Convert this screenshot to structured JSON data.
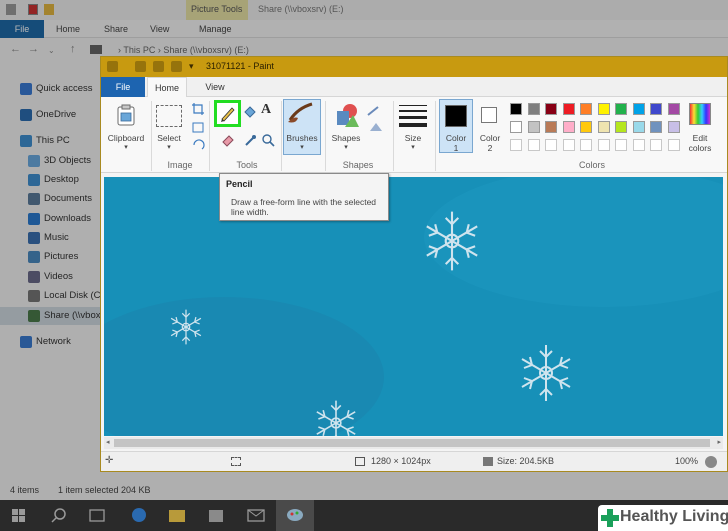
{
  "explorer": {
    "tools_tab": "Picture Tools",
    "title": "Share (\\\\vboxsrv) (E:)",
    "tabs": {
      "file": "File",
      "home": "Home",
      "share": "Share",
      "view": "View",
      "manage": "Manage"
    },
    "breadcrumb": "› This PC › Share (\\\\vboxsrv) (E:)",
    "nav": [
      {
        "label": "Quick access",
        "icon": "star-icon",
        "color": "#3a7bd5"
      },
      {
        "label": "OneDrive",
        "icon": "cloud-icon",
        "color": "#2b6cb0"
      },
      {
        "label": "This PC",
        "icon": "computer-icon",
        "color": "#3f8fd0"
      },
      {
        "label": "3D Objects",
        "icon": "cube-icon",
        "color": "#6aa9e0"
      },
      {
        "label": "Desktop",
        "icon": "desktop-icon",
        "color": "#3f8fd0"
      },
      {
        "label": "Documents",
        "icon": "documents-icon",
        "color": "#5a7a9a"
      },
      {
        "label": "Downloads",
        "icon": "download-icon",
        "color": "#2a7ad0"
      },
      {
        "label": "Music",
        "icon": "music-icon",
        "color": "#3a6fb0"
      },
      {
        "label": "Pictures",
        "icon": "pictures-icon",
        "color": "#4a8ac0"
      },
      {
        "label": "Videos",
        "icon": "videos-icon",
        "color": "#6a6a8a"
      },
      {
        "label": "Local Disk (C:",
        "icon": "disk-icon",
        "color": "#777777"
      },
      {
        "label": "Share (\\\\vbox",
        "icon": "network-drive-icon",
        "color": "#4a7a4a"
      },
      {
        "label": "Network",
        "icon": "network-icon",
        "color": "#3a7ad0"
      }
    ],
    "status_items": "4 items",
    "status_selected": "1 item selected  204 KB"
  },
  "paint": {
    "title": "31071121 - Paint",
    "tabs": {
      "file": "File",
      "home": "Home",
      "view": "View"
    },
    "ribbon": {
      "clipboard": "Clipboard",
      "select": "Select",
      "image_group": "Image",
      "tools_group": "Tools",
      "brushes": "Brushes",
      "shapes": "Shapes",
      "shapes_group": "Shapes",
      "size": "Size",
      "color1": "Color\n1",
      "color1_a": "Color",
      "color1_b": "1",
      "color2_a": "Color",
      "color2_b": "2",
      "colors_group": "Colors",
      "edit_colors_a": "Edit",
      "edit_colors_b": "colors"
    },
    "palette_row1": [
      "#000000",
      "#7f7f7f",
      "#880015",
      "#ed1c24",
      "#ff7f27",
      "#fff200",
      "#22b14c",
      "#00a2e8",
      "#3f48cc",
      "#a349a4"
    ],
    "palette_row2": [
      "#ffffff",
      "#c3c3c3",
      "#b97a57",
      "#ffaec9",
      "#ffc90e",
      "#efe4b0",
      "#b5e61d",
      "#99d9ea",
      "#7092be",
      "#c8bfe7"
    ],
    "tooltip": {
      "title": "Pencil",
      "description": "Draw a free-form line with the selected line width."
    },
    "status": {
      "dimensions": "1280 × 1024px",
      "size": "Size: 204.5KB",
      "zoom": "100%"
    }
  },
  "highlight_color": "#22dd22",
  "watermark": "Healthy Living"
}
